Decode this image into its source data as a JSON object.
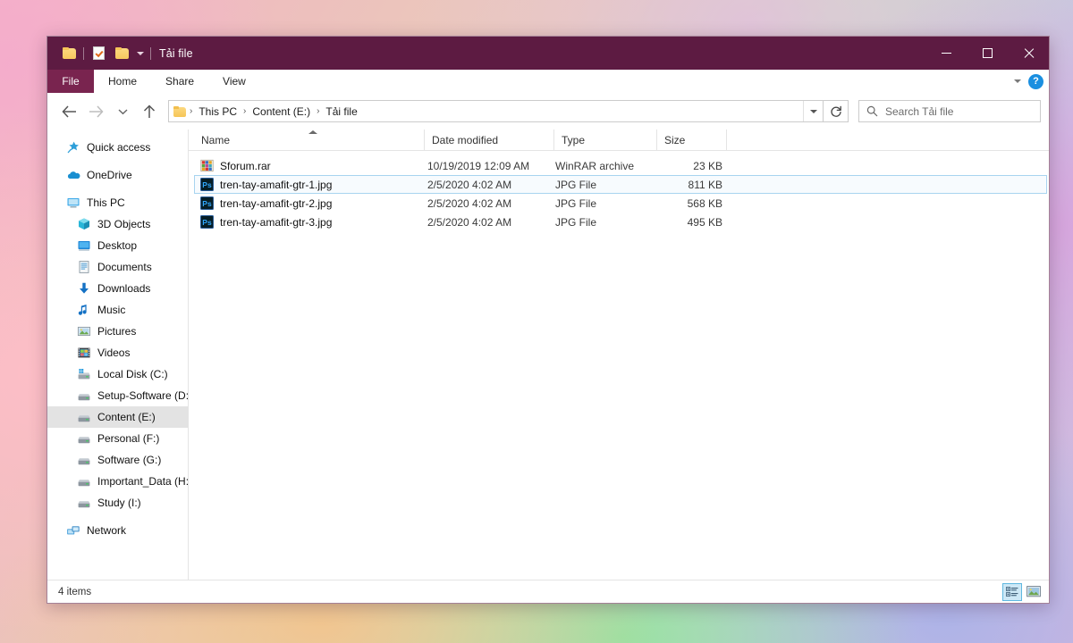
{
  "window": {
    "title": "Tải file",
    "quick_access": [
      {
        "name": "folder-icon",
        "label": "Folder"
      },
      {
        "name": "properties-icon",
        "label": "Properties"
      },
      {
        "name": "new-folder-icon",
        "label": "New folder"
      }
    ],
    "controls": {
      "minimize": "Minimize",
      "maximize": "Maximize",
      "close": "Close"
    }
  },
  "ribbon": {
    "file_tab": "File",
    "tabs": [
      {
        "label": "Home"
      },
      {
        "label": "Share"
      },
      {
        "label": "View"
      }
    ],
    "help_label": "?"
  },
  "address": {
    "back": "Back",
    "forward": "Forward",
    "recent": "Recent locations",
    "up": "Up",
    "breadcrumb": [
      {
        "label": "This PC"
      },
      {
        "label": "Content (E:)"
      },
      {
        "label": "Tải file"
      }
    ],
    "separator": "›",
    "refresh": "Refresh",
    "dropdown": "Previous locations"
  },
  "search": {
    "placeholder": "Search Tải file",
    "icon": "search-icon"
  },
  "sidebar": {
    "items": [
      {
        "label": "Quick access",
        "icon": "star-pin-icon",
        "level": 0,
        "selected": false
      },
      {
        "label": "OneDrive",
        "icon": "cloud-icon",
        "level": 0,
        "selected": false
      },
      {
        "label": "This PC",
        "icon": "monitor-icon",
        "level": 0,
        "selected": false
      },
      {
        "label": "3D Objects",
        "icon": "cube-icon",
        "level": 1,
        "selected": false
      },
      {
        "label": "Desktop",
        "icon": "desktop-icon",
        "level": 1,
        "selected": false
      },
      {
        "label": "Documents",
        "icon": "document-icon",
        "level": 1,
        "selected": false
      },
      {
        "label": "Downloads",
        "icon": "download-arrow-icon",
        "level": 1,
        "selected": false
      },
      {
        "label": "Music",
        "icon": "music-note-icon",
        "level": 1,
        "selected": false
      },
      {
        "label": "Pictures",
        "icon": "picture-icon",
        "level": 1,
        "selected": false
      },
      {
        "label": "Videos",
        "icon": "video-film-icon",
        "level": 1,
        "selected": false
      },
      {
        "label": "Local Disk (C:)",
        "icon": "windows-drive-icon",
        "level": 1,
        "selected": false
      },
      {
        "label": "Setup-Software (D:)",
        "icon": "drive-icon",
        "level": 1,
        "selected": false
      },
      {
        "label": "Content (E:)",
        "icon": "drive-icon",
        "level": 1,
        "selected": true
      },
      {
        "label": "Personal (F:)",
        "icon": "drive-icon",
        "level": 1,
        "selected": false
      },
      {
        "label": "Software (G:)",
        "icon": "drive-icon",
        "level": 1,
        "selected": false
      },
      {
        "label": "Important_Data (H:)",
        "icon": "drive-icon",
        "level": 1,
        "selected": false
      },
      {
        "label": "Study (I:)",
        "icon": "drive-icon",
        "level": 1,
        "selected": false
      },
      {
        "label": "Network",
        "icon": "network-icon",
        "level": 0,
        "selected": false
      }
    ]
  },
  "file_list": {
    "columns": [
      {
        "key": "name",
        "label": "Name",
        "sorted": true,
        "sort_dir": "asc"
      },
      {
        "key": "date",
        "label": "Date modified"
      },
      {
        "key": "type",
        "label": "Type"
      },
      {
        "key": "size",
        "label": "Size"
      }
    ],
    "rows": [
      {
        "name": "Sforum.rar",
        "date": "10/19/2019 12:09 AM",
        "type": "WinRAR archive",
        "size": "23 KB",
        "icon": "winrar-archive-icon",
        "selected": false
      },
      {
        "name": "tren-tay-amafit-gtr-1.jpg",
        "date": "2/5/2020 4:02 AM",
        "type": "JPG File",
        "size": "811 KB",
        "icon": "photoshop-file-icon",
        "selected": true
      },
      {
        "name": "tren-tay-amafit-gtr-2.jpg",
        "date": "2/5/2020 4:02 AM",
        "type": "JPG File",
        "size": "568 KB",
        "icon": "photoshop-file-icon",
        "selected": false
      },
      {
        "name": "tren-tay-amafit-gtr-3.jpg",
        "date": "2/5/2020 4:02 AM",
        "type": "JPG File",
        "size": "495 KB",
        "icon": "photoshop-file-icon",
        "selected": false
      }
    ]
  },
  "status": {
    "item_count": "4 items",
    "views": [
      {
        "name": "details-view-button",
        "label": "Details view",
        "active": true
      },
      {
        "name": "large-icons-view-button",
        "label": "Large icons view",
        "active": false
      }
    ]
  },
  "colors": {
    "title_bar": "#5d1b42",
    "file_tab": "#79244f",
    "selection_blue": "#a8d4f0",
    "sidebar_selected": "#e3e3e3",
    "accent_ps": "#31a8ff"
  }
}
